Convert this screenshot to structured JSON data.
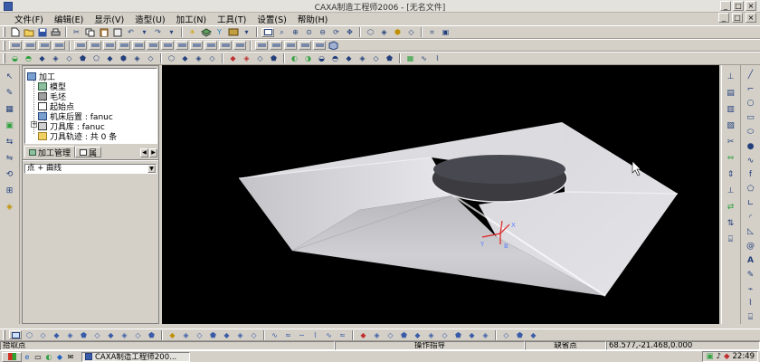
{
  "window": {
    "title": "CAXA制造工程师2006 - [无名文件]",
    "controls": [
      "_",
      "□",
      "×"
    ]
  },
  "menu": {
    "items": [
      "文件(F)",
      "编辑(E)",
      "显示(V)",
      "造型(U)",
      "加工(N)",
      "工具(T)",
      "设置(S)",
      "帮助(H)"
    ],
    "mdi_controls": [
      "_",
      "□",
      "×"
    ]
  },
  "panel": {
    "tree": {
      "root": "加工",
      "children": [
        "模型",
        "毛坯",
        "起始点",
        "机床后置 : fanuc",
        "刀具库 : fanuc",
        "刀具轨迹 : 共 0 条"
      ]
    },
    "tabs": [
      "加工管理",
      "属"
    ],
    "tab_arrows": [
      "◀",
      "▶"
    ],
    "combo": {
      "value": "点 + 曲线"
    }
  },
  "viewport": {
    "background": "#000000",
    "model_color": "#c8c8cc",
    "axis_labels": [
      "Y",
      "X",
      "B"
    ]
  },
  "status": {
    "left": "拾取点",
    "center": "操作指导",
    "mode": "缺省点",
    "coords": "68.577,-21.468,0.000"
  },
  "taskbar": {
    "task": "CAXA制造工程师200...",
    "clock": "22:49"
  },
  "colors": {
    "chrome": "#d4d0c8",
    "icon_blue": "#24407c",
    "viewport": "#000000"
  }
}
